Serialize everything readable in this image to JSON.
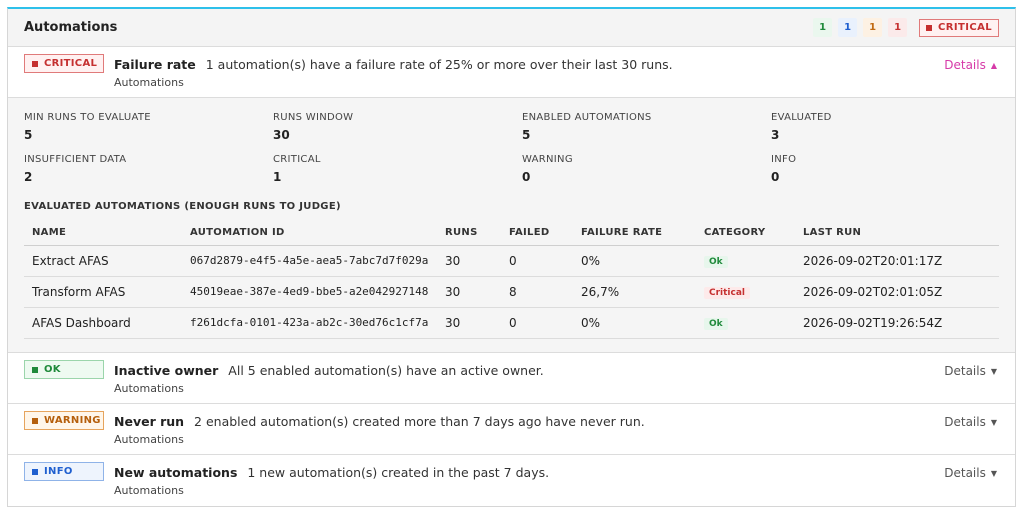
{
  "panel": {
    "title": "Automations",
    "counts": {
      "ok": "1",
      "info": "1",
      "warning": "1",
      "critical": "1"
    },
    "overall_status": "CRITICAL"
  },
  "checks": [
    {
      "status": "CRITICAL",
      "name": "Failure rate",
      "message": "1 automation(s) have a failure rate of 25% or more over their last 30 runs.",
      "subtitle": "Automations",
      "details_label": "Details",
      "expanded": true
    },
    {
      "status": "OK",
      "name": "Inactive owner",
      "message": "All 5 enabled automation(s) have an active owner.",
      "subtitle": "Automations",
      "details_label": "Details",
      "expanded": false
    },
    {
      "status": "WARNING",
      "name": "Never run",
      "message": "2 enabled automation(s) created more than 7 days ago have never run.",
      "subtitle": "Automations",
      "details_label": "Details",
      "expanded": false
    },
    {
      "status": "INFO",
      "name": "New automations",
      "message": "1 new automation(s) created in the past 7 days.",
      "subtitle": "Automations",
      "details_label": "Details",
      "expanded": false
    }
  ],
  "failure_details": {
    "stats": [
      {
        "label": "MIN RUNS TO EVALUATE",
        "value": "5"
      },
      {
        "label": "RUNS WINDOW",
        "value": "30"
      },
      {
        "label": "ENABLED AUTOMATIONS",
        "value": "5"
      },
      {
        "label": "EVALUATED",
        "value": "3"
      },
      {
        "label": "INSUFFICIENT DATA",
        "value": "2"
      },
      {
        "label": "CRITICAL",
        "value": "1"
      },
      {
        "label": "WARNING",
        "value": "0"
      },
      {
        "label": "INFO",
        "value": "0"
      }
    ],
    "section_title": "EVALUATED AUTOMATIONS (ENOUGH RUNS TO JUDGE)",
    "columns": [
      "NAME",
      "AUTOMATION ID",
      "RUNS",
      "FAILED",
      "FAILURE RATE",
      "CATEGORY",
      "LAST RUN"
    ],
    "rows": [
      {
        "name": "Extract AFAS",
        "id": "067d2879-e4f5-4a5e-aea5-7abc7d7f029a",
        "runs": "30",
        "failed": "0",
        "rate": "0%",
        "category": "Ok",
        "last_run": "2026-09-02T20:01:17Z"
      },
      {
        "name": "Transform AFAS",
        "id": "45019eae-387e-4ed9-bbe5-a2e042927148",
        "runs": "30",
        "failed": "8",
        "rate": "26,7%",
        "category": "Critical",
        "last_run": "2026-09-02T02:01:05Z"
      },
      {
        "name": "AFAS Dashboard",
        "id": "f261dcfa-0101-423a-ab2c-30ed76c1cf7a",
        "runs": "30",
        "failed": "0",
        "rate": "0%",
        "category": "Ok",
        "last_run": "2026-09-02T19:26:54Z"
      }
    ]
  },
  "colors": {
    "accent": "#2ec0ea",
    "critical": "#c53030",
    "ok": "#1f8a3b",
    "warning": "#b55f0c",
    "info": "#1f5fcf",
    "details_open": "#d63aa8"
  }
}
